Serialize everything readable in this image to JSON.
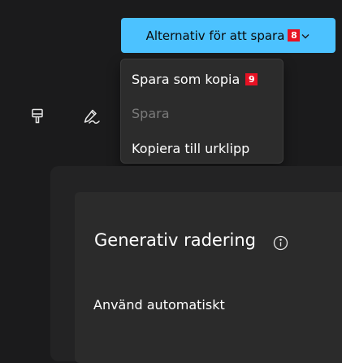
{
  "toolbar": {
    "save_options_label": "Alternativ för att spara",
    "save_options_badge": "8",
    "brush_icon": "paint-brush-icon",
    "pen_icon": "pen-icon"
  },
  "save_menu": {
    "items": [
      {
        "label": "Spara som kopia",
        "badge": "9",
        "enabled": true
      },
      {
        "label": "Spara",
        "enabled": false
      },
      {
        "label": "Kopiera till urklipp",
        "enabled": true
      }
    ]
  },
  "panel": {
    "title": "Generativ radering",
    "info_icon": "info-icon",
    "auto_apply_label": "Använd automatiskt"
  },
  "colors": {
    "background": "#1b1b1c",
    "accent": "#4cc2ff",
    "badge": "#e81123",
    "menu_background": "#2c2c2c",
    "disabled_text": "#7a7a7a"
  }
}
